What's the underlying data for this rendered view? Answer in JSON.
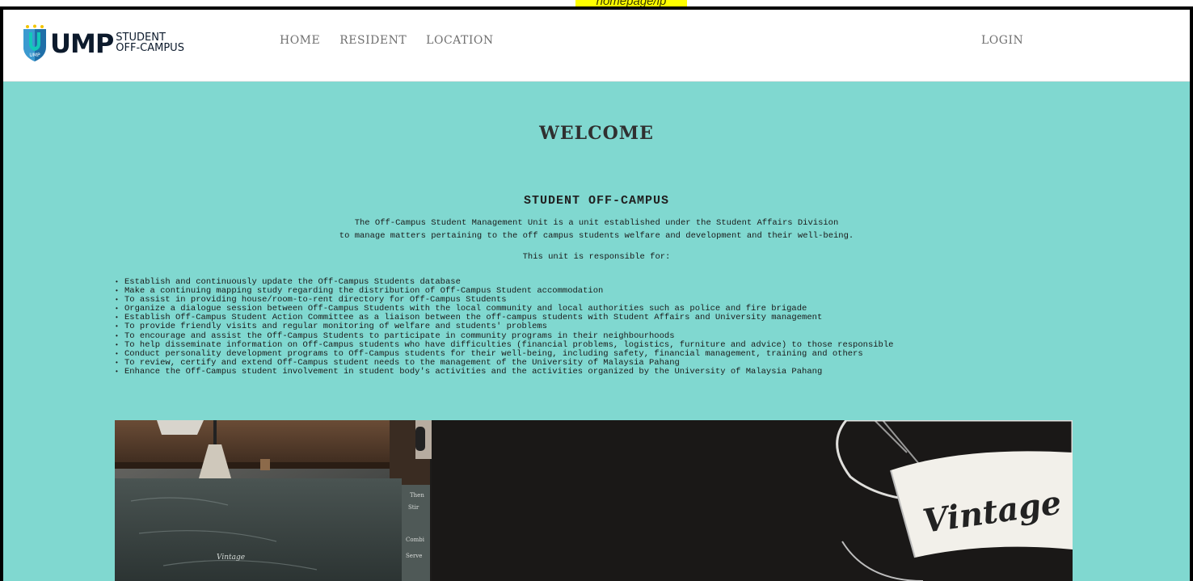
{
  "caption": "homepage/lp",
  "brand": {
    "mark": "UMP",
    "line1": "STUDENT",
    "line2": "OFF-CAMPUS"
  },
  "nav": {
    "items": [
      {
        "label": "HOME"
      },
      {
        "label": "RESIDENT"
      },
      {
        "label": "LOCATION"
      }
    ],
    "login": "LOGIN"
  },
  "page": {
    "welcome": "WELCOME",
    "section_title": "STUDENT OFF-CAMPUS",
    "intro_line1": "The Off-Campus Student Management Unit is a unit established under the Student Affairs Division",
    "intro_line2": "to manage matters pertaining to the off campus students welfare and development and their well-being.",
    "responsible_heading": "This unit is responsible for:",
    "duties": [
      "Establish and continuously update the Off-Campus Students database",
      "Make a continuing mapping study regarding the distribution of Off-Campus Student accommodation",
      "To assist in providing house/room-to-rent directory for Off-Campus Students",
      "Organize a dialogue session between Off-Campus Students with the local community and local authorities such as police and fire brigade",
      "Establish Off-Campus Student Action Committee as a liaison between the off-campus students with Student Affairs and University management",
      "To provide friendly visits and regular monitoring of welfare and students' problems",
      "To encourage and assist the Off-Campus Students to participate in community programs in their neighbourhoods",
      "To help disseminate information on Off-Campus students who have difficulties (financial problems, logistics, furniture and advice) to those responsible",
      "Conduct personality development programs to Off-Campus students for their well-being, including safety, financial management, training and others",
      "To review, certify and extend Off-Campus student needs to the management of the University of Malaysia Pahang",
      "Enhance the Off-Campus student involvement in student body's activities and the activities organized by the University of Malaysia Pahang"
    ],
    "hero_sign_text": "Vintage",
    "hero_board_text": "Vintage"
  },
  "colors": {
    "background": "#80d8d0",
    "navbar": "#ffffff",
    "nav_text": "#707070",
    "caption_highlight": "#ffff00"
  },
  "icons": {
    "logo": "shield-icon"
  }
}
